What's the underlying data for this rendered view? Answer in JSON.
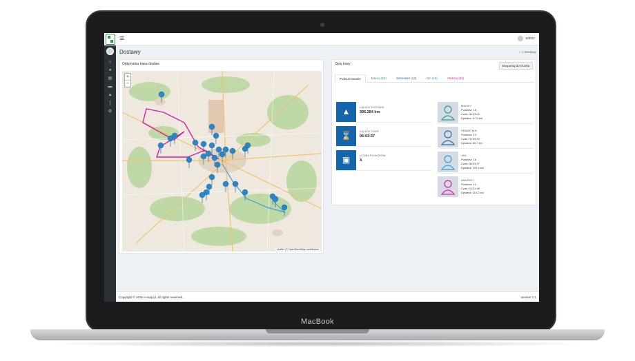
{
  "device": {
    "label": "MacBook"
  },
  "topbar": {
    "menu_icon": "hamburger-icon",
    "user_name": "admin"
  },
  "sidebar": {
    "icons": [
      "home-icon",
      "group-icon",
      "store-icon",
      "truck-icon",
      "car-icon",
      "fork-knife-icon",
      "gears-icon"
    ]
  },
  "page": {
    "title": "Dostawy",
    "breadcrumb": "Dostawy"
  },
  "map_panel": {
    "title": "Optymalna trasa dostaw",
    "zoom_in": "+",
    "zoom_out": "−",
    "attribution": "Leaflet | © OpenStreetMap contributors",
    "route_colors": [
      "#d61fa8",
      "#3aa3d6"
    ],
    "pin_color": "#2a86c9"
  },
  "stats_panel": {
    "title": "Opis trasy",
    "export_label": "Eksportuj do excela",
    "tabs": [
      {
        "label": "Podsumowanie",
        "color": "#333333"
      },
      {
        "label": "Maciej (15)",
        "color": "#2e9d8f"
      },
      {
        "label": "Sebastian (13)",
        "color": "#2e6da4"
      },
      {
        "label": "Jan (16)",
        "color": "#2ea1d6"
      },
      {
        "label": "Andrzej (11)",
        "color": "#d61fa8"
      }
    ],
    "stats": [
      {
        "label": "ŁĄCZNY DYSTANS",
        "value": "395.284 km",
        "icon": "road-icon"
      },
      {
        "label": "ŁĄCZNY CZAS",
        "value": "06:03:37",
        "icon": "hourglass-icon"
      },
      {
        "label": "LICZBA POJAZDÓW",
        "value": "4",
        "icon": "car-icon"
      }
    ],
    "drivers": [
      {
        "name": "MACIEJ",
        "color": "#2e9d8f",
        "line1": "Punktów: 15",
        "line2": "Czas: 06:03:03",
        "line3": "Dystans: 67.9 km"
      },
      {
        "name": "SEBASTIAN",
        "color": "#2e6da4",
        "line1": "Punktów: 13",
        "line2": "Czas: 04:09:24",
        "line3": "Dystans: 65.7 km"
      },
      {
        "name": "JAN",
        "color": "#2ea1d6",
        "line1": "Punktów: 16",
        "line2": "Czas: 06:03:37",
        "line3": "Dystans: 103.4 km"
      },
      {
        "name": "ANDRZEJ",
        "color": "#d61fa8",
        "line1": "Punktów: 11",
        "line2": "Czas: 04:31:48",
        "line3": "Dystans: 115.2 km"
      }
    ]
  },
  "footer": {
    "copyright": "Copyright © 2016 e-map.pl, All rights reserved.",
    "version": "Version 1.1"
  }
}
